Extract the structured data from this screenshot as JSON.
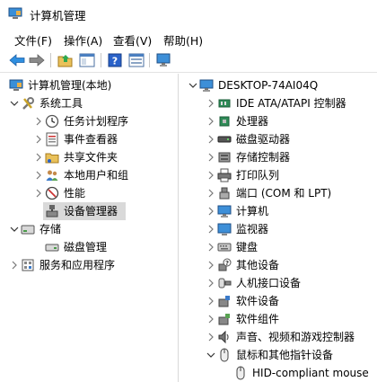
{
  "window": {
    "title": "计算机管理"
  },
  "menu": [
    "文件(F)",
    "操作(A)",
    "查看(V)",
    "帮助(H)"
  ],
  "left_tree": {
    "root": "计算机管理(本地)",
    "system_tools": "系统工具",
    "system_children": [
      "任务计划程序",
      "事件查看器",
      "共享文件夹",
      "本地用户和组",
      "性能",
      "设备管理器"
    ],
    "storage": "存储",
    "disk_management": "磁盘管理",
    "services": "服务和应用程序"
  },
  "right_tree": {
    "computer": "DESKTOP-74AI04Q",
    "categories": [
      "IDE ATA/ATAPI 控制器",
      "处理器",
      "磁盘驱动器",
      "存储控制器",
      "打印队列",
      "端口 (COM 和 LPT)",
      "计算机",
      "监视器",
      "键盘",
      "其他设备",
      "人机接口设备",
      "软件设备",
      "软件组件",
      "声音、视频和游戏控制器",
      "鼠标和其他指针设备"
    ],
    "mouse_child": "HID-compliant mouse"
  },
  "colors": {
    "accent": "#1e73d8",
    "selection": "#d9d9d9"
  }
}
